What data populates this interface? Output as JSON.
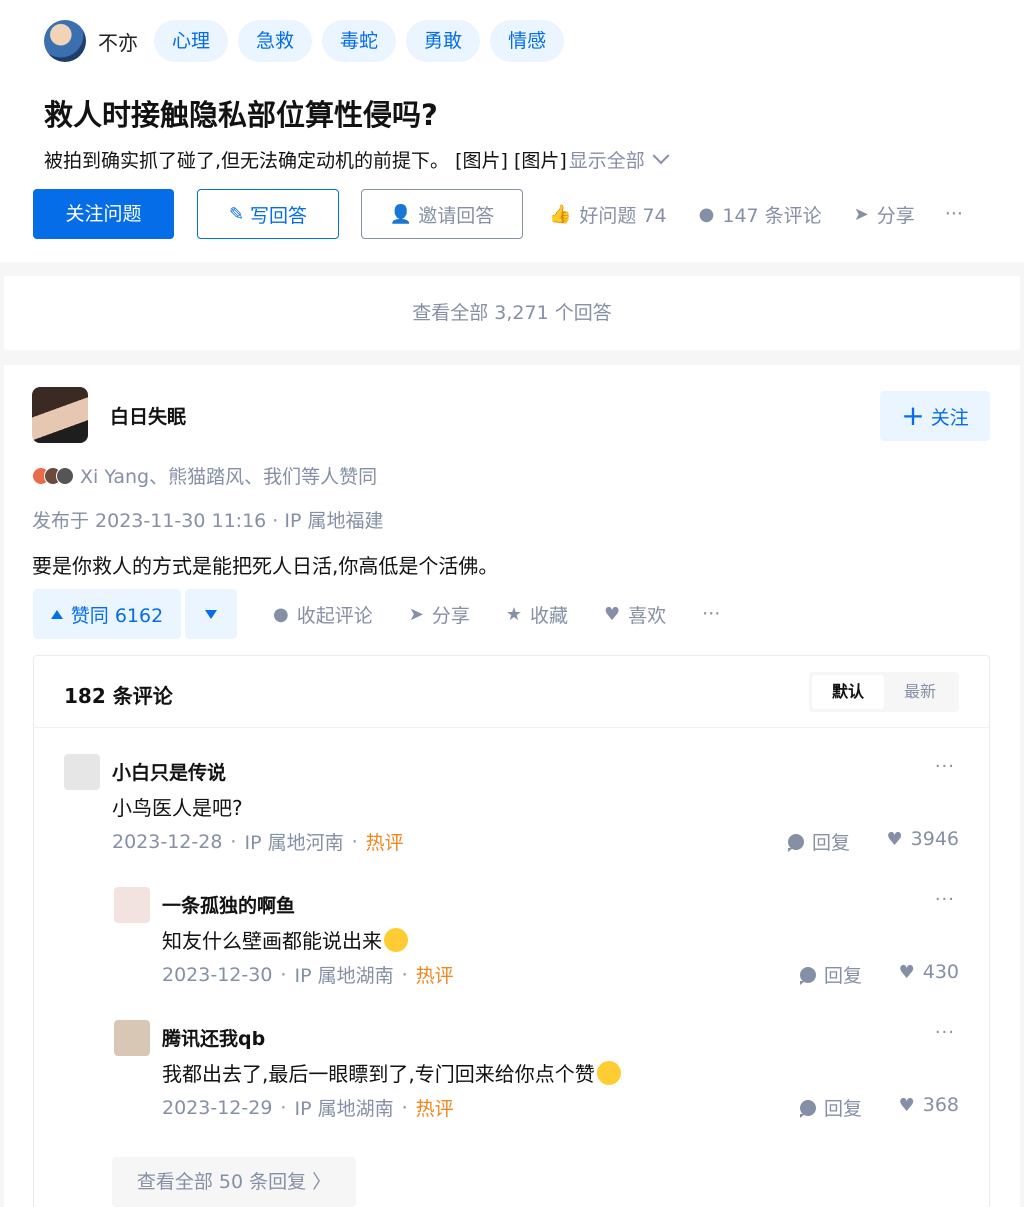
{
  "question": {
    "asker": "不亦",
    "tags": [
      "心理",
      "急救",
      "毒蛇",
      "勇敢",
      "情感"
    ],
    "title": "救人时接触隐私部位算性侵吗?",
    "desc": "被拍到确实抓了碰了,但无法确定动机的前提下。 [图片] [图片]",
    "show_all": "显示全部",
    "follow_label": "关注问题",
    "write_label": "写回答",
    "invite_label": "邀请回答",
    "good_question": "好问题 74",
    "comments": "147 条评论",
    "share": "分享",
    "more": "···"
  },
  "all_answers": "查看全部 3,271 个回答",
  "answer": {
    "author": "白日失眠",
    "follow": "关注",
    "voters": "Xi Yang、熊猫踏风、我们等人赞同",
    "pubtime": "发布于 2023-11-30 11:16 · IP 属地福建",
    "text": "要是你救人的方式是能把死人日活,你高低是个活佛。",
    "vote_up": "赞同 6162",
    "collapse_comments": "收起评论",
    "share": "分享",
    "collect": "收藏",
    "like": "喜欢",
    "more": "···"
  },
  "comments": {
    "count": "182 条评论",
    "sort_default": "默认",
    "sort_latest": "最新",
    "reply_label": "回复",
    "hot_label": "热评",
    "items": [
      {
        "name": "小白只是传说",
        "text": "小鸟医人是吧?",
        "date": "2023-12-28",
        "ip": "IP 属地河南",
        "likes": "3946"
      },
      {
        "name": "一条孤独的啊鱼",
        "text": "知友什么壁画都能说出来",
        "date": "2023-12-30",
        "ip": "IP 属地湖南",
        "likes": "430"
      },
      {
        "name": "腾讯还我qb",
        "text": "我都出去了,最后一眼瞟到了,专门回来给你点个赞",
        "date": "2023-12-29",
        "ip": "IP 属地湖南",
        "likes": "368"
      }
    ],
    "view_all": "查看全部 50 条回复 〉"
  }
}
